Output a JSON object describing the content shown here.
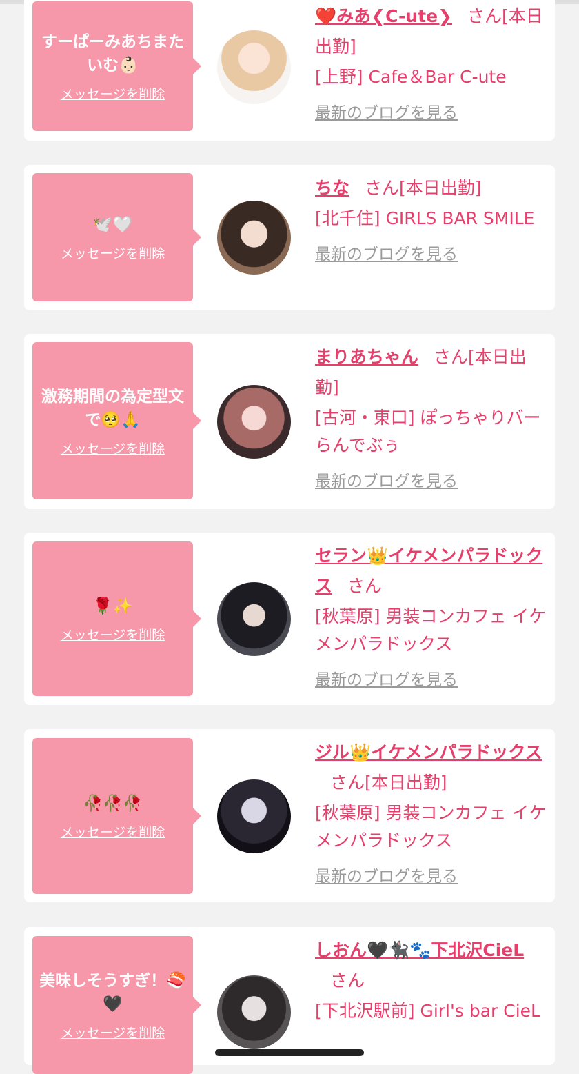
{
  "common": {
    "delete_label": "メッセージを削除",
    "blog_label": "最新のブログを見る"
  },
  "cards": [
    {
      "message": "すーぱーみあちまたいむ👶🏻",
      "name": "❤️みあ❮C-ute❯",
      "suffix": "さん[本日出勤]",
      "shop": "[上野] Cafe＆Bar C-ute"
    },
    {
      "message": "🕊️🤍",
      "name": "ちな",
      "suffix": "さん[本日出勤]",
      "shop": "[北千住] GIRLS BAR SMILE"
    },
    {
      "message": "激務期間の為定型文で🥺🙏",
      "name": "まりあちゃん",
      "suffix": "さん[本日出勤]",
      "shop": "[古河・東口] ぽっちゃりバー らんでぶぅ"
    },
    {
      "message": "🌹✨",
      "name": "セラン👑イケメンパラドックス",
      "suffix": "さん",
      "shop": "[秋葉原] 男装コンカフェ イケメンパラドックス"
    },
    {
      "message": "🥀🥀🥀",
      "name": "ジル👑イケメンパラドックス",
      "suffix": "さん[本日出勤]",
      "shop": "[秋葉原] 男装コンカフェ イケメンパラドックス"
    },
    {
      "message": "美味しそうすぎ！🍣🖤",
      "name": "しおん🖤🐈‍⬛🐾下北沢CieL",
      "suffix": "さん",
      "shop": "[下北沢駅前] Girl's bar CieL"
    }
  ]
}
